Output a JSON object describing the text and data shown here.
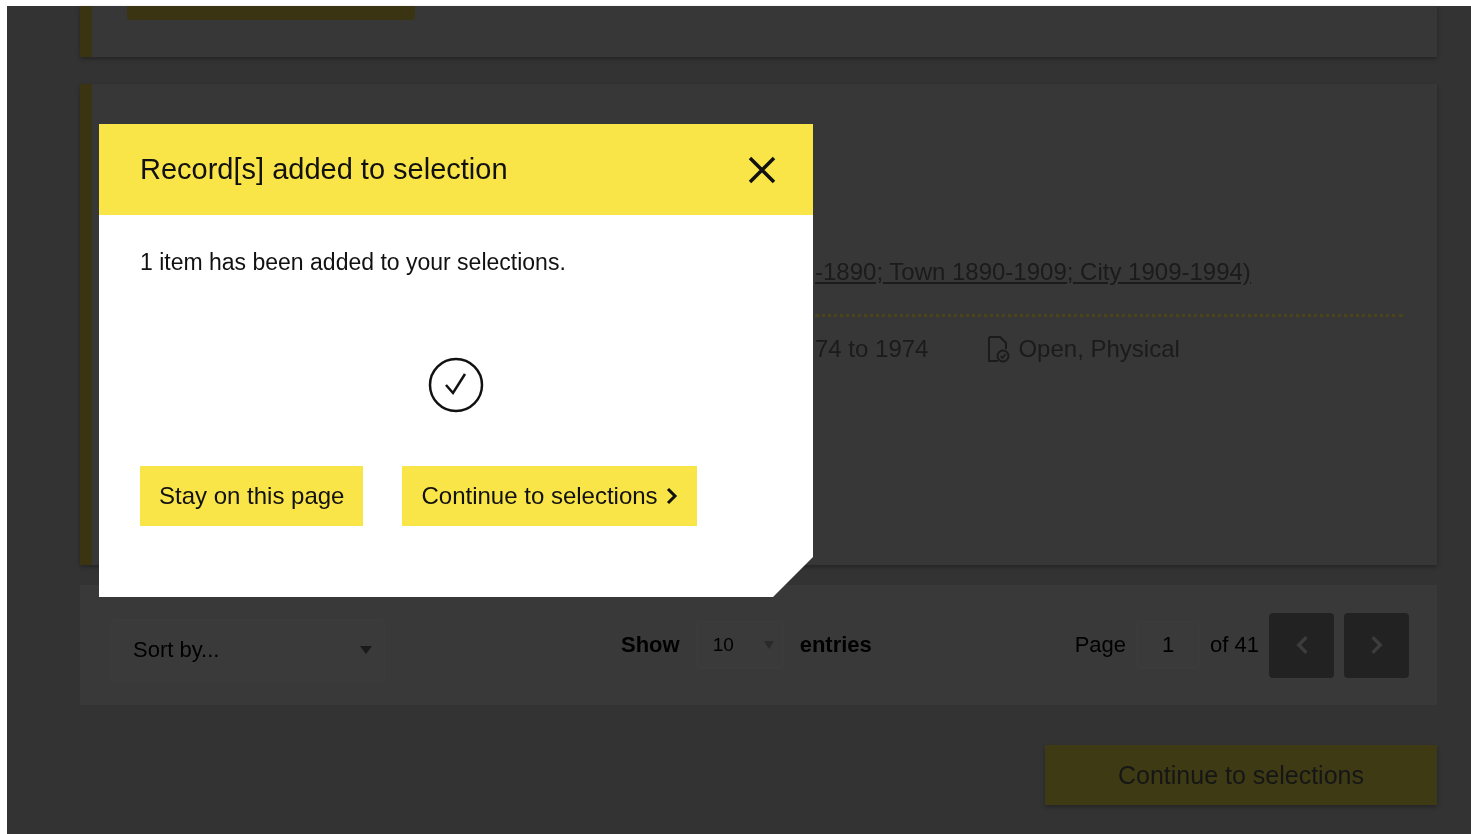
{
  "record_card": {
    "link_text": "-1890; Town 1890-1909; City 1909-1994)",
    "date_range": "74 to 1974",
    "access": "Open, Physical"
  },
  "modal": {
    "title": "Record[s] added to selection",
    "message": "1 item has been added to your selections.",
    "buttons": [
      {
        "label": "Stay on this page",
        "kind": "plain"
      },
      {
        "label": "Continue to selections",
        "kind": "next"
      }
    ]
  },
  "controls": {
    "sort_value": "Sort by...",
    "show_label": "Show",
    "entries_value": "10",
    "entries_label": "entries",
    "page_label": "Page",
    "page_value": "1",
    "page_total": "of 41"
  },
  "footer_button": "Continue to selections"
}
